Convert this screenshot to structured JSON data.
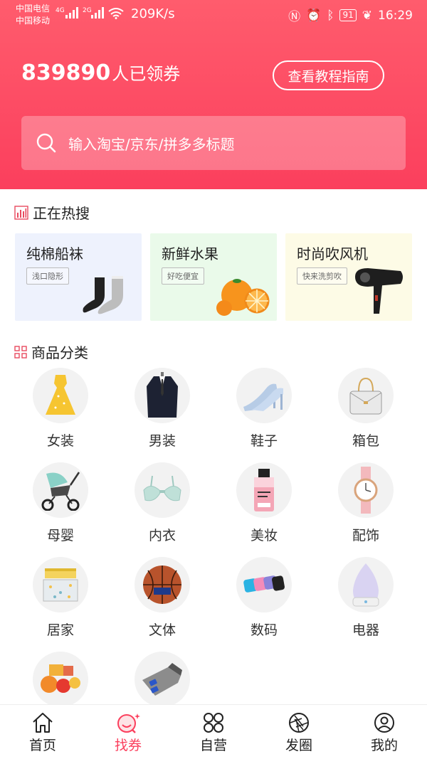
{
  "status_bar": {
    "carrier1": "中国电信",
    "carrier2": "中国移动",
    "net1": "4G",
    "net2": "2G",
    "speed": "209K/s",
    "battery": "91",
    "time": "16:29"
  },
  "header": {
    "count": "839890",
    "count_suffix": "人已领券",
    "guide_button": "查看教程指南",
    "search_placeholder": "输入淘宝/京东/拼多多标题",
    "gradient_top": "#ff5c6d",
    "gradient_bottom": "#fb3f5d"
  },
  "hot": {
    "title": "正在热搜",
    "items": [
      {
        "title": "纯棉船袜",
        "tag": "浅口隐形",
        "bg": "#eef2fd",
        "icon": "socks-image"
      },
      {
        "title": "新鲜水果",
        "tag": "好吃便宜",
        "bg": "#eafaea",
        "icon": "oranges-image"
      },
      {
        "title": "时尚吹风机",
        "tag": "快来洗剪吹",
        "bg": "#fdfbe6",
        "icon": "hair-dryer-image"
      }
    ]
  },
  "categories": {
    "title": "商品分类",
    "items": [
      {
        "label": "女装",
        "icon": "dress-image"
      },
      {
        "label": "男装",
        "icon": "suit-image"
      },
      {
        "label": "鞋子",
        "icon": "heels-image"
      },
      {
        "label": "箱包",
        "icon": "handbag-image"
      },
      {
        "label": "母婴",
        "icon": "stroller-image"
      },
      {
        "label": "内衣",
        "icon": "bra-image"
      },
      {
        "label": "美妆",
        "icon": "cosmetics-image"
      },
      {
        "label": "配饰",
        "icon": "watch-image"
      },
      {
        "label": "居家",
        "icon": "bedding-image"
      },
      {
        "label": "文体",
        "icon": "basketball-image"
      },
      {
        "label": "数码",
        "icon": "powerbank-image"
      },
      {
        "label": "电器",
        "icon": "humidifier-image"
      },
      {
        "label": "",
        "icon": "food-image"
      },
      {
        "label": "",
        "icon": "car-charger-image"
      }
    ]
  },
  "bottom_nav": {
    "items": [
      {
        "label": "首页",
        "icon": "home-icon"
      },
      {
        "label": "找券",
        "icon": "coupon-search-icon",
        "active": true
      },
      {
        "label": "自营",
        "icon": "grid-icon"
      },
      {
        "label": "发圈",
        "icon": "aperture-icon"
      },
      {
        "label": "我的",
        "icon": "profile-icon"
      }
    ],
    "active_color": "#fb3f5d"
  }
}
